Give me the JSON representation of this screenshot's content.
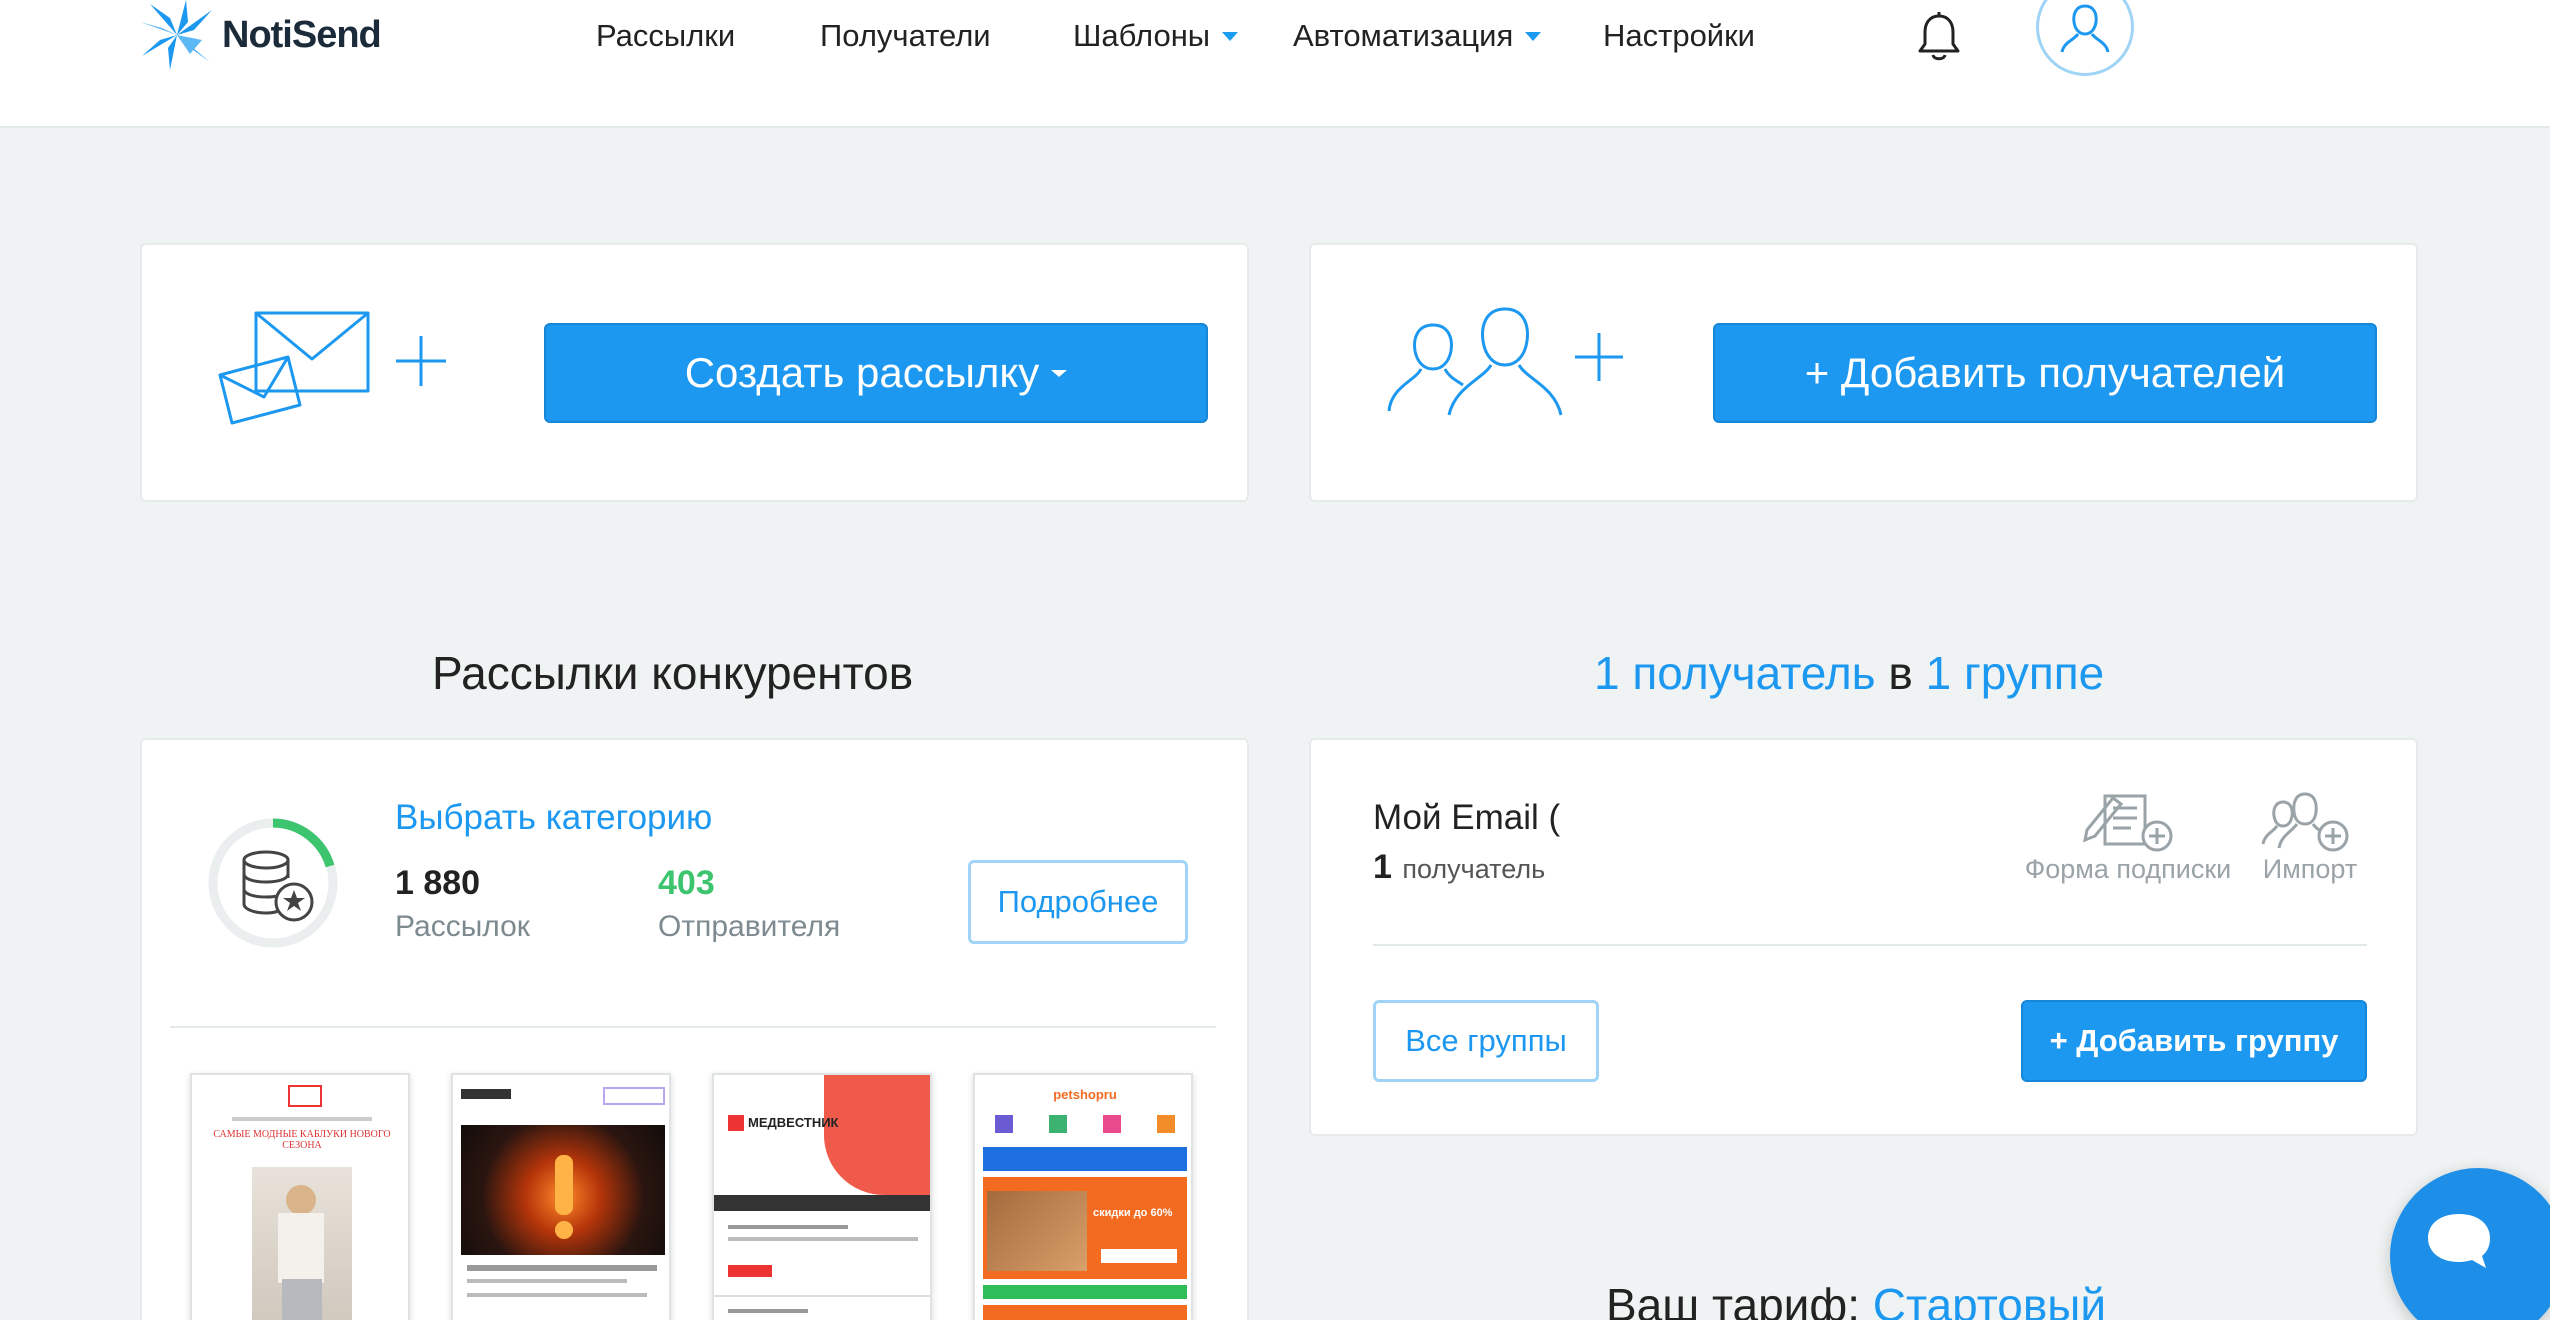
{
  "app": {
    "logo_text": "NotiSend"
  },
  "nav": {
    "items": [
      {
        "label": "Рассылки"
      },
      {
        "label": "Получатели"
      },
      {
        "label": "Шаблоны"
      },
      {
        "label": "Автоматизация"
      },
      {
        "label": "Настройки"
      }
    ]
  },
  "actions": {
    "create_campaign_label": "Создать рассылку",
    "add_recipients_label": "+ Добавить получателей"
  },
  "competitors": {
    "title": "Рассылки конкурентов",
    "category_link": "Выбрать категорию",
    "campaigns_count": "1 880",
    "campaigns_label": "Рассылок",
    "senders_count": "403",
    "senders_label": "Отправителя",
    "details_button": "Подробнее",
    "thumbnails": [
      "thumb-fashion",
      "thumb-vakansii",
      "thumb-medvestnik",
      "thumb-petshop"
    ],
    "thumb_texts": {
      "medvestnik": "МЕДВЕСТНИК",
      "petshop": "petshopru",
      "petshop_promo": "скидки до 60%",
      "fashion": "САМЫЕ МОДНЫЕ КАБЛУКИ НОВОГО СЕЗОНА"
    }
  },
  "recipients": {
    "title_count": "1 получатель",
    "title_in": "в",
    "title_groups": "1 группе",
    "group_name": "Мой Email (",
    "group_count": "1",
    "group_count_label": "получатель",
    "form_label": "Форма подписки",
    "import_label": "Импорт",
    "all_groups_button": "Все группы",
    "add_group_button": "+ Добавить группу"
  },
  "tariff": {
    "label": "Ваш тариф:",
    "name": "Стартовый"
  },
  "colors": {
    "accent": "#1c98f0",
    "green": "#3cc46e",
    "background": "#f0f3f3"
  }
}
